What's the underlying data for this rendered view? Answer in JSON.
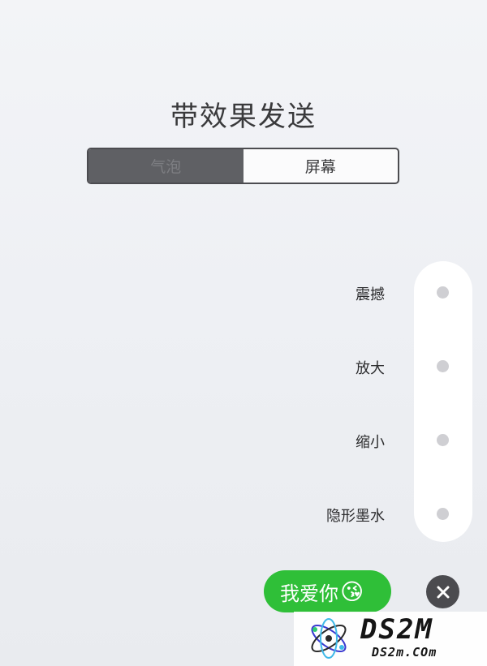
{
  "header": {
    "title": "带效果发送"
  },
  "segmented": {
    "options": [
      {
        "label": "气泡",
        "selected": true
      },
      {
        "label": "屏幕",
        "selected": false
      }
    ]
  },
  "effects": [
    {
      "label": "震撼"
    },
    {
      "label": "放大"
    },
    {
      "label": "缩小"
    },
    {
      "label": "隐形墨水"
    }
  ],
  "message": {
    "text": "我爱你",
    "emoji": "😘",
    "bubble_color": "#2fbf38"
  },
  "close": {
    "icon": "close-icon"
  },
  "watermark": {
    "brand": "DS2M",
    "site": "DS2m.COm"
  }
}
